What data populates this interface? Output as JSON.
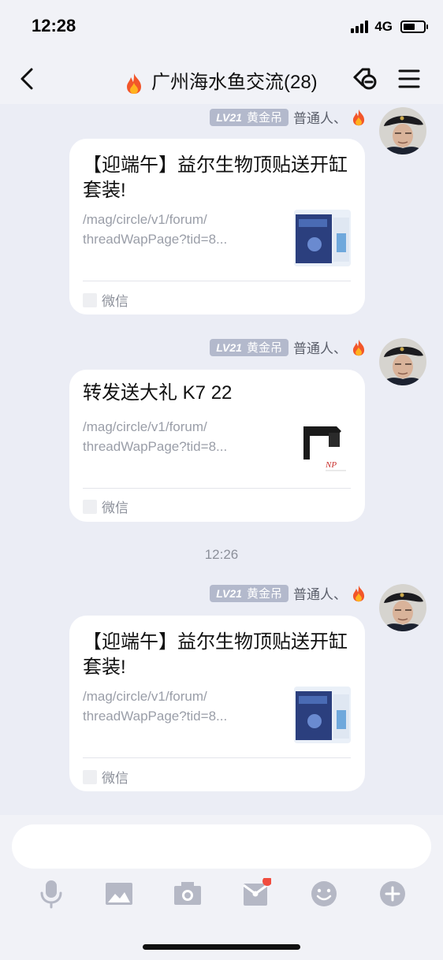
{
  "status_bar": {
    "time": "12:28",
    "network": "4G"
  },
  "header": {
    "title": "广州海水鱼交流(28)"
  },
  "messages": [
    {
      "level": "LV21",
      "level_title": "黄金吊",
      "sender": "普通人、",
      "card": {
        "title": "【迎端午】益尔生物顶贴送开缸套装!",
        "url_line1": "/mag/circle/v1/forum/",
        "url_line2": "threadWapPage?tid=8...",
        "source": "微信"
      }
    },
    {
      "level": "LV21",
      "level_title": "黄金吊",
      "sender": "普通人、",
      "card": {
        "title": "转发送大礼 K7 22",
        "url_line1": "/mag/circle/v1/forum/",
        "url_line2": "threadWapPage?tid=8...",
        "source": "微信"
      }
    },
    {
      "timestamp": "12:26",
      "level": "LV21",
      "level_title": "黄金吊",
      "sender": "普通人、",
      "card": {
        "title": "【迎端午】益尔生物顶贴送开缸套装!",
        "url_line1": "/mag/circle/v1/forum/",
        "url_line2": "threadWapPage?tid=8...",
        "source": "微信"
      }
    }
  ],
  "thumb_text": "NP",
  "input": {
    "placeholder": ""
  },
  "toolbar": [
    "microphone-icon",
    "image-icon",
    "camera-icon",
    "red-packet-icon",
    "emoji-icon",
    "plus-icon"
  ],
  "colors": {
    "badge": "#b3b9cc",
    "notification_dot": "#f04c3e",
    "icon_gray": "#b5b8c5"
  }
}
